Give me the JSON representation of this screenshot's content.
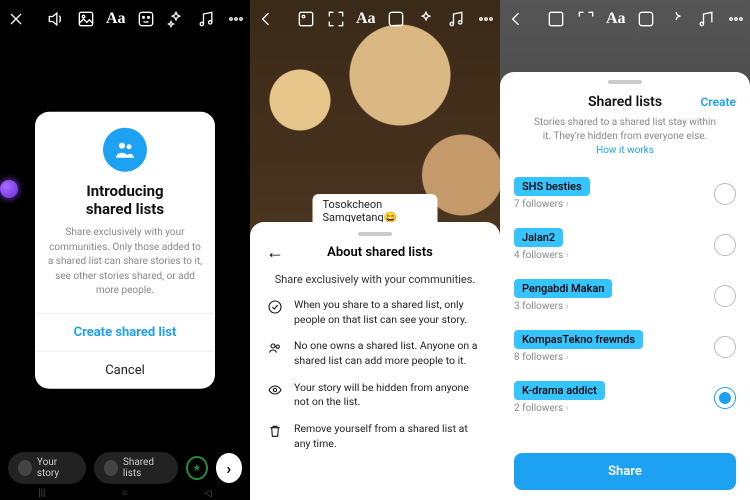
{
  "panel1": {
    "modal": {
      "title_line1": "Introducing",
      "title_line2": "shared lists",
      "body": "Share exclusively with your communities. Only those added to a shared list can share stories to it, see other stories shared, or add more people.",
      "primary": "Create shared list",
      "cancel": "Cancel"
    },
    "chips": {
      "your_story": "Your story",
      "shared_lists": "Shared lists"
    }
  },
  "panel2": {
    "caption": "Tosokcheon Samgyetang😄",
    "sheet": {
      "title": "About shared lists",
      "subtitle": "Share exclusively with your communities.",
      "bullets": [
        "When you share to a shared list, only people on that list can see your story.",
        "No one owns a shared list. Anyone on a shared list can add more people to it.",
        "Your story will be hidden from anyone not on the list.",
        "Remove yourself from a shared list at any time."
      ]
    }
  },
  "panel3": {
    "title": "Shared lists",
    "create": "Create",
    "subtitle": "Stories shared to a shared list stay within it. They're hidden from everyone else. ",
    "how": "How it works",
    "lists": [
      {
        "name": "SHS besties",
        "followers": "7 followers",
        "selected": false
      },
      {
        "name": "Jalan2",
        "followers": "4 followers",
        "selected": false
      },
      {
        "name": "Pengabdi Makan",
        "followers": "3 followers",
        "selected": false
      },
      {
        "name": "KompasTekno frewnds",
        "followers": "8 followers",
        "selected": false
      },
      {
        "name": "K-drama addict",
        "followers": "2 followers",
        "selected": true
      }
    ],
    "share": "Share"
  },
  "icons": {
    "aa": "Aa"
  }
}
